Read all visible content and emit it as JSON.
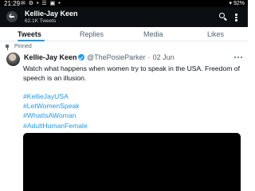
{
  "status_bar": {
    "time": "21:29",
    "icons": "✉ ⚙ • ☰ ▣ •",
    "wifi": "▾",
    "battery": "92%"
  },
  "header": {
    "name": "Kellie-Jay Keen",
    "tweet_count": "62.1K Tweets"
  },
  "tabs": [
    {
      "label": "Tweets",
      "active": true
    },
    {
      "label": "Replies",
      "active": false
    },
    {
      "label": "Media",
      "active": false
    },
    {
      "label": "Likes",
      "active": false
    }
  ],
  "tweet": {
    "pinned_label": "Pinned",
    "display_name": "Kellie-Jay Keen",
    "handle": "@ThePosieParker",
    "separator": "·",
    "date": "02 Jun",
    "text": "Watch what happens when women try to speak in the USA. Freedom of speech is an illusion.",
    "hashtags": [
      "#KellieJayUSA",
      "#LetWomenSpeak",
      "#WhatIsAWoman",
      "#AdultHumanFemale"
    ]
  },
  "colors": {
    "accent": "#1d9bf0",
    "header_bg": "#0b0f12",
    "secondary_text": "#536471"
  }
}
